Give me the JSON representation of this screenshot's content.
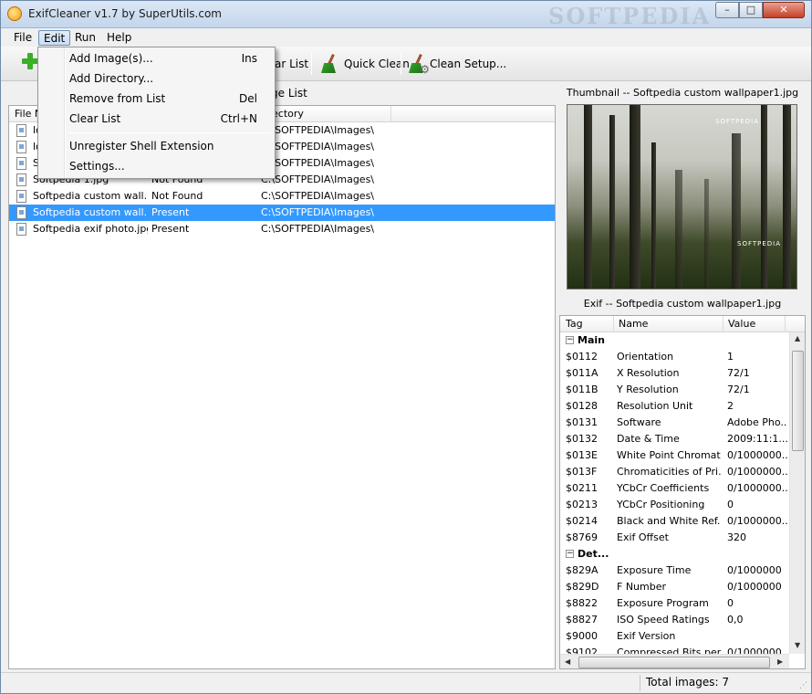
{
  "window": {
    "title": "ExifCleaner v1.7 by SuperUtils.com",
    "watermark": "SOFTPEDIA",
    "min": "–",
    "max": "□",
    "close": "✕"
  },
  "menubar": {
    "file": "File",
    "edit": "Edit",
    "run": "Run",
    "help": "Help"
  },
  "toolbar": {
    "clear_list": "ar List",
    "quick_clean": "Quick Clean",
    "clean_setup": "Clean Setup..."
  },
  "dropdown": [
    {
      "label": "Add Image(s)...",
      "shortcut": "Ins"
    },
    {
      "label": "Add Directory...",
      "shortcut": ""
    },
    {
      "label": "Remove from List",
      "shortcut": "Del"
    },
    {
      "label": "Clear List",
      "shortcut": "Ctrl+N"
    },
    {
      "label": "Unregister Shell Extension",
      "shortcut": ""
    },
    {
      "label": "Settings...",
      "shortcut": ""
    }
  ],
  "list": {
    "title": "ge List",
    "columns": {
      "file_name": "File N",
      "exif": "",
      "directory": "ectory"
    },
    "rows": [
      {
        "name": "lo",
        "exif": "",
        "dir": "C:\\SOFTPEDIA\\Images\\"
      },
      {
        "name": "lo",
        "exif": "",
        "dir": "C:\\SOFTPEDIA\\Images\\"
      },
      {
        "name": "S",
        "exif": "",
        "dir": "C:\\SOFTPEDIA\\Images\\"
      },
      {
        "name": "Softpedia 1.jpg",
        "exif": "Not Found",
        "dir": "C:\\SOFTPEDIA\\Images\\"
      },
      {
        "name": "Softpedia custom wall...",
        "exif": "Not Found",
        "dir": "C:\\SOFTPEDIA\\Images\\"
      },
      {
        "name": "Softpedia custom wall...",
        "exif": "Present",
        "dir": "C:\\SOFTPEDIA\\Images\\"
      },
      {
        "name": "Softpedia exif photo.jpg",
        "exif": "Present",
        "dir": "C:\\SOFTPEDIA\\Images\\"
      }
    ]
  },
  "thumbnail": {
    "title": "Thumbnail -- Softpedia custom wallpaper1.jpg",
    "logo_top": "SOFTPEDIA",
    "logo_bottom": "SOFTPEDIA"
  },
  "exif": {
    "title": "Exif -- Softpedia custom wallpaper1.jpg",
    "columns": {
      "tag": "Tag",
      "name": "Name",
      "value": "Value"
    },
    "group_main": "Main",
    "group_details": "Det...",
    "main_rows": [
      {
        "tag": "$0112",
        "name": "Orientation",
        "value": "1"
      },
      {
        "tag": "$011A",
        "name": "X Resolution",
        "value": "72/1"
      },
      {
        "tag": "$011B",
        "name": "Y Resolution",
        "value": "72/1"
      },
      {
        "tag": "$0128",
        "name": "Resolution Unit",
        "value": "2"
      },
      {
        "tag": "$0131",
        "name": "Software",
        "value": "Adobe Pho..."
      },
      {
        "tag": "$0132",
        "name": "Date & Time",
        "value": "2009:11:1..."
      },
      {
        "tag": "$013E",
        "name": "White Point Chromati...",
        "value": "0/1000000..."
      },
      {
        "tag": "$013F",
        "name": "Chromaticities of Pri...",
        "value": "0/1000000..."
      },
      {
        "tag": "$0211",
        "name": "YCbCr Coefficients",
        "value": "0/1000000..."
      },
      {
        "tag": "$0213",
        "name": "YCbCr Positioning",
        "value": "0"
      },
      {
        "tag": "$0214",
        "name": "Black and White Ref...",
        "value": "0/1000000..."
      },
      {
        "tag": "$8769",
        "name": "Exif Offset",
        "value": "320"
      }
    ],
    "detail_rows": [
      {
        "tag": "$829A",
        "name": "Exposure Time",
        "value": "0/1000000"
      },
      {
        "tag": "$829D",
        "name": "F Number",
        "value": "0/1000000"
      },
      {
        "tag": "$8822",
        "name": "Exposure Program",
        "value": "0"
      },
      {
        "tag": "$8827",
        "name": "ISO Speed Ratings",
        "value": "0,0"
      },
      {
        "tag": "$9000",
        "name": "Exif Version",
        "value": ""
      },
      {
        "tag": "$9102",
        "name": "Compressed Bits per...",
        "value": "0/1000000"
      }
    ]
  },
  "status": {
    "total_images": "Total images: 7"
  }
}
